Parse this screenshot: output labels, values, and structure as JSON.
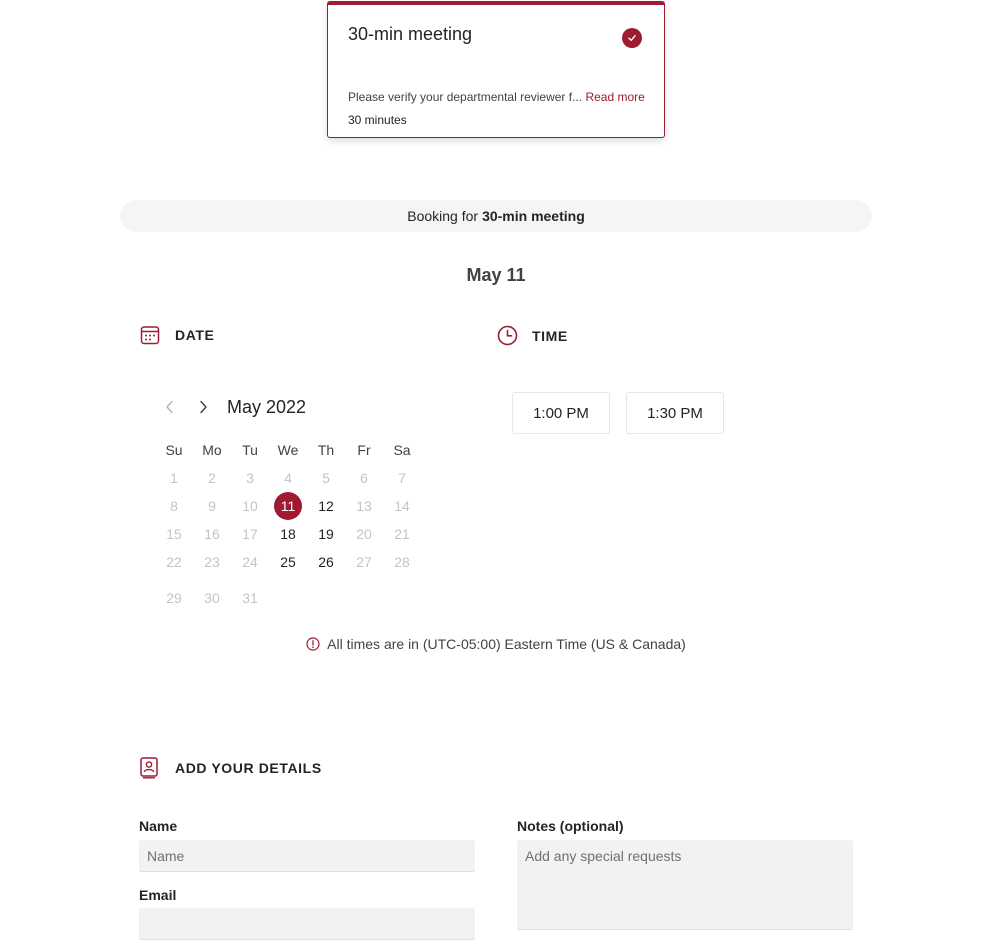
{
  "service": {
    "title": "30-min meeting",
    "description": "Please verify your departmental reviewer f...",
    "read_more": "Read more",
    "duration": "30 minutes"
  },
  "booking_bar": {
    "prefix": "Booking for",
    "service_name": "30-min meeting"
  },
  "selected_date_heading": "May 11",
  "date_section": {
    "label": "DATE"
  },
  "time_section": {
    "label": "TIME"
  },
  "calendar": {
    "month_label": "May 2022",
    "weekdays": [
      "Su",
      "Mo",
      "Tu",
      "We",
      "Th",
      "Fr",
      "Sa"
    ],
    "weeks": [
      [
        "1",
        "2",
        "3",
        "4",
        "5",
        "6",
        "7"
      ],
      [
        "8",
        "9",
        "10",
        "11",
        "12",
        "13",
        "14"
      ],
      [
        "15",
        "16",
        "17",
        "18",
        "19",
        "20",
        "21"
      ],
      [
        "22",
        "23",
        "24",
        "25",
        "26",
        "27",
        "28"
      ],
      [
        "29",
        "30",
        "31",
        "",
        "",
        "",
        ""
      ]
    ],
    "available_days": [
      "11",
      "12",
      "18",
      "19",
      "25",
      "26"
    ],
    "selected_day": "11"
  },
  "time_slots": [
    "1:00 PM",
    "1:30 PM"
  ],
  "timezone_note": "All times are in (UTC-05:00) Eastern Time (US & Canada)",
  "details_section": {
    "label": "ADD YOUR DETAILS"
  },
  "form": {
    "name_label": "Name",
    "name_placeholder": "Name",
    "email_label": "Email",
    "notes_label": "Notes (optional)",
    "notes_placeholder": "Add any special requests"
  },
  "colors": {
    "accent": "#9e1b32",
    "text": "#242424",
    "muted": "#c4c4c4",
    "bar_bg": "#f5f5f5",
    "input_bg": "#f2f2f2"
  }
}
